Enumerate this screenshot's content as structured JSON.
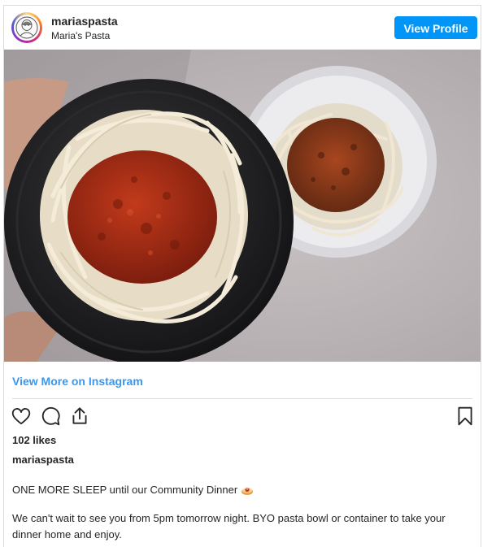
{
  "header": {
    "username": "mariaspasta",
    "full_name": "Maria's Pasta",
    "view_profile_label": "View Profile"
  },
  "photo": {
    "alt": "Two plates of fettuccine with bolognese sauce"
  },
  "link": {
    "label": "View More on Instagram"
  },
  "actions": {
    "like_icon": "heart-icon",
    "comment_icon": "comment-icon",
    "share_icon": "share-icon",
    "save_icon": "bookmark-icon"
  },
  "likes": "102 likes",
  "caption": {
    "username": "mariaspasta",
    "line1": "ONE MORE SLEEP until our Community Dinner",
    "line1_emoji": "spaghetti-emoji",
    "paragraph2": "We can't wait to see you from 5pm tomorrow night. BYO pasta bowl or container to take your dinner home and enjoy."
  },
  "colors": {
    "accent": "#0095f6",
    "link": "#3897f0",
    "text": "#262626",
    "border": "#dbdbdb"
  }
}
